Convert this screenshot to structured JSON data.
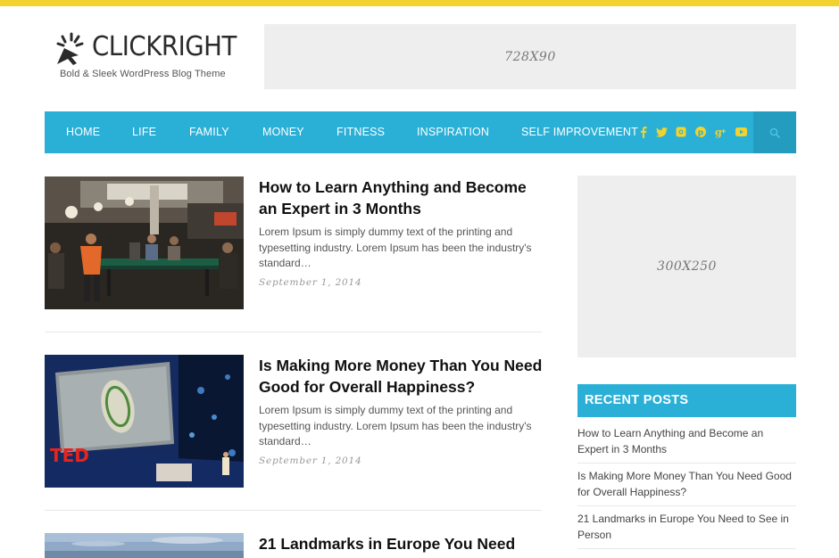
{
  "colors": {
    "accent": "#2ab0d7",
    "top_bar": "#f2d22e"
  },
  "header": {
    "logo_text": "CLICKRIGHT",
    "tagline": "Bold & Sleek WordPress Blog Theme",
    "leaderboard_ad": "728X90"
  },
  "nav": {
    "items": [
      "HOME",
      "LIFE",
      "FAMILY",
      "MONEY",
      "FITNESS",
      "INSPIRATION",
      "SELF IMPROVEMENT"
    ],
    "social_icons": [
      "facebook-icon",
      "twitter-icon",
      "instagram-icon",
      "pinterest-icon",
      "google-plus-icon",
      "youtube-icon"
    ],
    "search_icon": "search-icon"
  },
  "posts": [
    {
      "title": "How to Learn Anything and Become an Expert in 3 Months",
      "excerpt": "Lorem Ipsum is simply dummy text of the printing and typesetting industry. Lorem Ipsum has been the industry's standard…",
      "date": "September 1, 2014"
    },
    {
      "title": "Is Making More Money Than You Need Good for Overall Happiness?",
      "excerpt": "Lorem Ipsum is simply dummy text of the printing and typesetting industry. Lorem Ipsum has been the industry's standard…",
      "date": "September 1, 2014"
    },
    {
      "title": "21 Landmarks in Europe You Need"
    }
  ],
  "sidebar": {
    "ad_label": "300X250",
    "recent_title": "RECENT POSTS",
    "recent_posts": [
      "How to Learn Anything and Become an Expert in 3 Months",
      "Is Making More Money Than You Need Good for Overall Happiness?",
      "21 Landmarks in Europe You Need to See in Person"
    ]
  }
}
